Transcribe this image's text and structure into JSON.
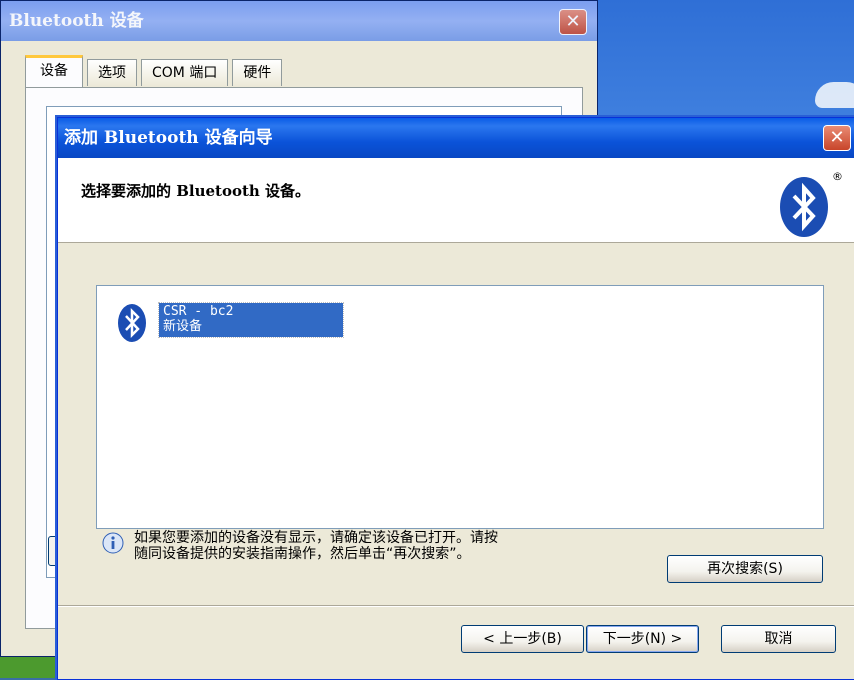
{
  "back_window": {
    "title": "Bluetooth 设备",
    "close_glyph": "✕",
    "tabs": [
      {
        "label": "设备",
        "active": true
      },
      {
        "label": "选项",
        "active": false
      },
      {
        "label": "COM 端口",
        "active": false
      },
      {
        "label": "硬件",
        "active": false
      }
    ]
  },
  "wizard": {
    "title": "添加 Bluetooth 设备向导",
    "close_glyph": "✕",
    "heading": "选择要添加的 Bluetooth 设备。",
    "registered_mark": "®",
    "device": {
      "name": "CSR - bc2",
      "status": "新设备",
      "icon": "bluetooth-icon"
    },
    "info_lines": [
      "如果您要添加的设备没有显示，请确定该设备已打开。请按",
      "随同设备提供的安装指南操作，然后单击“再次搜索”。"
    ],
    "buttons": {
      "rescan": "再次搜索(S)",
      "back": "< 上一步(B)",
      "next": "下一步(N) >",
      "cancel": "取消"
    }
  },
  "colors": {
    "title_bar": "#0a5ce6",
    "selection": "#316ac5",
    "bluetooth_blue": "#1b4db3"
  }
}
